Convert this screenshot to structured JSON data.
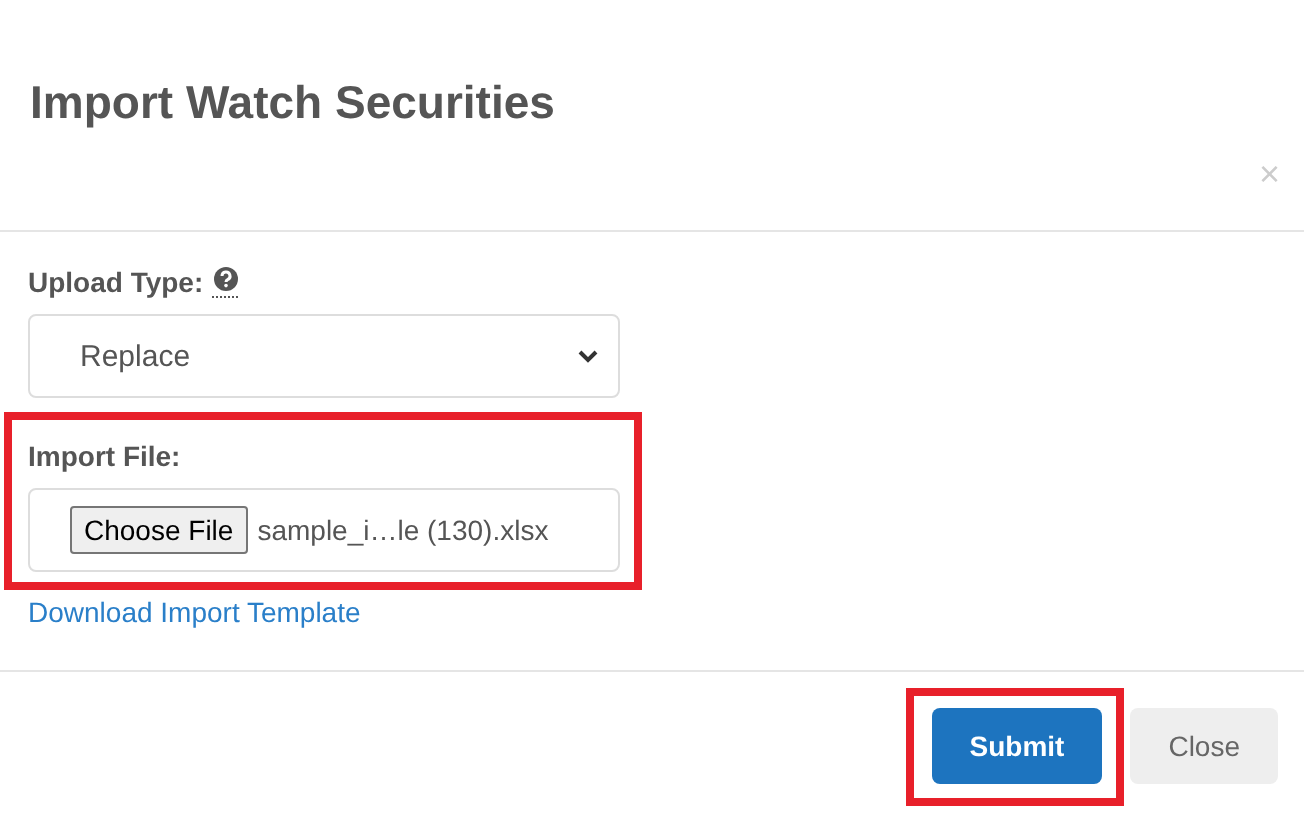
{
  "dialog": {
    "title": "Import Watch Securities",
    "close_glyph": "×"
  },
  "upload_type": {
    "label": "Upload Type:",
    "value": "Replace"
  },
  "import_file": {
    "label": "Import File:",
    "button": "Choose File",
    "filename": "sample_i…le (130).xlsx",
    "highlighted": true
  },
  "template_link": "Download Import Template",
  "buttons": [
    {
      "label": "Submit",
      "kind": "primary",
      "highlighted": true
    },
    {
      "label": "Close",
      "kind": "secondary",
      "highlighted": false
    }
  ]
}
